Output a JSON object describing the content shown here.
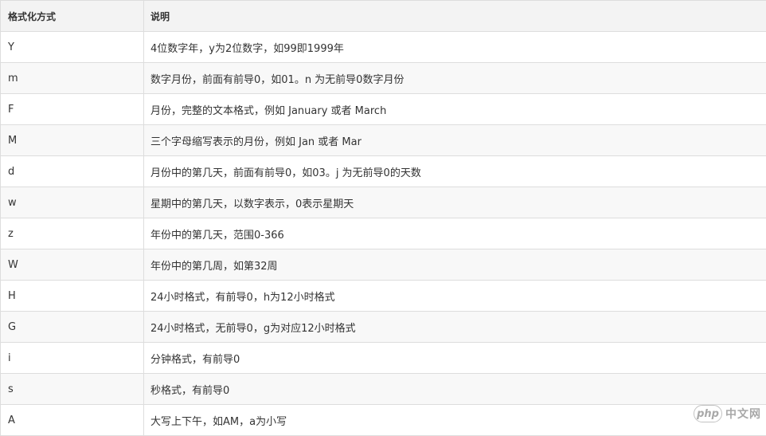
{
  "table": {
    "headers": [
      "格式化方式",
      "说明"
    ],
    "rows": [
      {
        "code": "Y",
        "desc": "4位数字年，y为2位数字，如99即1999年"
      },
      {
        "code": "m",
        "desc": "数字月份，前面有前导0，如01。n 为无前导0数字月份"
      },
      {
        "code": "F",
        "desc": "月份，完整的文本格式，例如 January 或者 March"
      },
      {
        "code": "M",
        "desc": "三个字母缩写表示的月份，例如 Jan 或者 Mar"
      },
      {
        "code": "d",
        "desc": "月份中的第几天，前面有前导0，如03。j 为无前导0的天数"
      },
      {
        "code": "w",
        "desc": "星期中的第几天，以数字表示，0表示星期天"
      },
      {
        "code": "z",
        "desc": "年份中的第几天，范围0-366"
      },
      {
        "code": "W",
        "desc": "年份中的第几周，如第32周"
      },
      {
        "code": "H",
        "desc": "24小时格式，有前导0，h为12小时格式"
      },
      {
        "code": "G",
        "desc": "24小时格式，无前导0，g为对应12小时格式"
      },
      {
        "code": "i",
        "desc": "分钟格式，有前导0"
      },
      {
        "code": "s",
        "desc": "秒格式，有前导0"
      },
      {
        "code": "A",
        "desc": "大写上下午，如AM，a为小写"
      }
    ]
  },
  "watermark": {
    "badge": "php",
    "text": "中文网"
  }
}
